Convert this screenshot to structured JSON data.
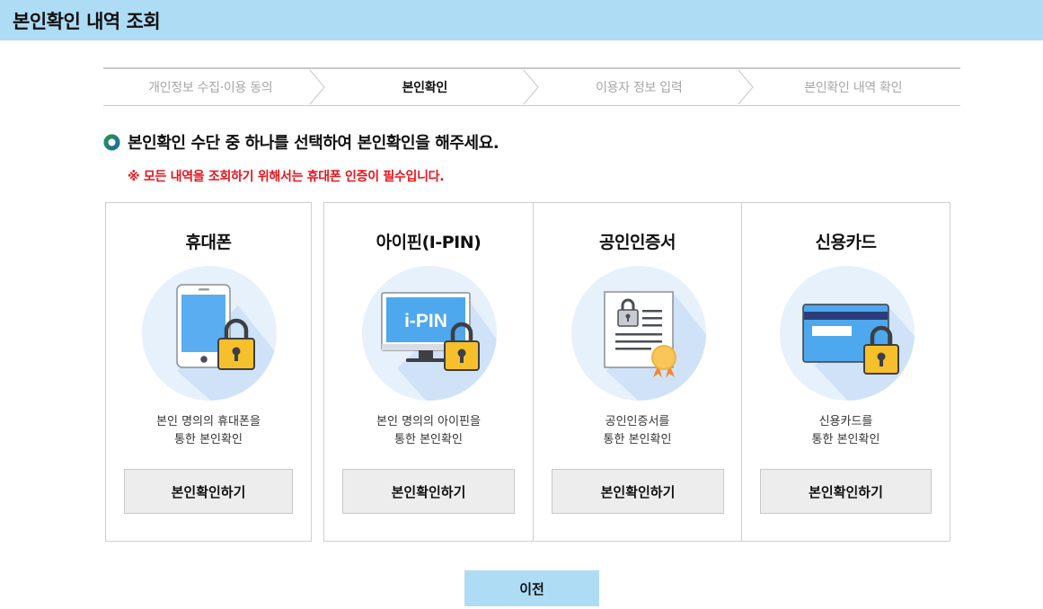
{
  "header": {
    "title": "본인확인 내역 조회"
  },
  "steps": [
    {
      "label": "개인정보 수집·이용 동의"
    },
    {
      "label": "본인확인"
    },
    {
      "label": "이용자 정보 입력"
    },
    {
      "label": "본인확인 내역 확인"
    }
  ],
  "active_step_index": 1,
  "notice": {
    "main": "본인확인 수단 중 하나를 선택하여 본인확인을 해주세요.",
    "warning": "※ 모든 내역을 조회하기 위해서는 휴대폰 인증이 필수입니다."
  },
  "methods": [
    {
      "title": "휴대폰",
      "desc_line1": "본인 명의의 휴대폰을",
      "desc_line2": "통한 본인확인",
      "button": "본인확인하기",
      "icon": "phone-lock-icon"
    },
    {
      "title": "아이핀(I-PIN)",
      "desc_line1": "본인 명의의 아이핀을",
      "desc_line2": "통한 본인확인",
      "button": "본인확인하기",
      "icon": "ipin-monitor-lock-icon",
      "icon_text": "i-PIN"
    },
    {
      "title": "공인인증서",
      "desc_line1": "공인인증서를",
      "desc_line2": "통한 본인확인",
      "button": "본인확인하기",
      "icon": "certificate-icon"
    },
    {
      "title": "신용카드",
      "desc_line1": "신용카드를",
      "desc_line2": "통한 본인확인",
      "button": "본인확인하기",
      "icon": "credit-card-lock-icon"
    }
  ],
  "footer": {
    "prev_button": "이전"
  },
  "colors": {
    "header_bg": "#aedcf5",
    "warning": "#e8131a",
    "button_bg": "#ededed",
    "prev_bg": "#aedcf5",
    "icon_circle": "#e6f1fc",
    "lock_yellow": "#f6c02c"
  }
}
